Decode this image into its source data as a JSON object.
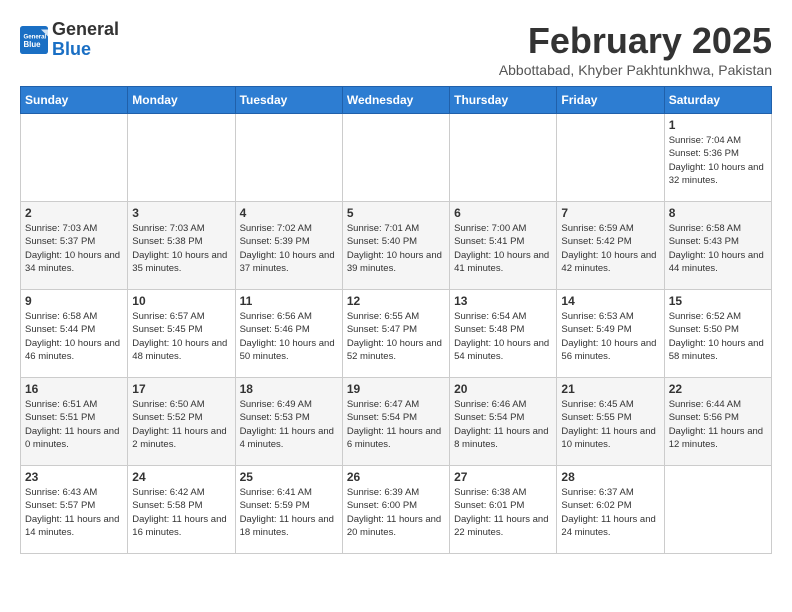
{
  "header": {
    "logo_line1": "General",
    "logo_line2": "Blue",
    "title": "February 2025",
    "subtitle": "Abbottabad, Khyber Pakhtunkhwa, Pakistan"
  },
  "days_of_week": [
    "Sunday",
    "Monday",
    "Tuesday",
    "Wednesday",
    "Thursday",
    "Friday",
    "Saturday"
  ],
  "weeks": [
    [
      {
        "day": "",
        "info": ""
      },
      {
        "day": "",
        "info": ""
      },
      {
        "day": "",
        "info": ""
      },
      {
        "day": "",
        "info": ""
      },
      {
        "day": "",
        "info": ""
      },
      {
        "day": "",
        "info": ""
      },
      {
        "day": "1",
        "info": "Sunrise: 7:04 AM\nSunset: 5:36 PM\nDaylight: 10 hours\nand 32 minutes."
      }
    ],
    [
      {
        "day": "2",
        "info": "Sunrise: 7:03 AM\nSunset: 5:37 PM\nDaylight: 10 hours\nand 34 minutes."
      },
      {
        "day": "3",
        "info": "Sunrise: 7:03 AM\nSunset: 5:38 PM\nDaylight: 10 hours\nand 35 minutes."
      },
      {
        "day": "4",
        "info": "Sunrise: 7:02 AM\nSunset: 5:39 PM\nDaylight: 10 hours\nand 37 minutes."
      },
      {
        "day": "5",
        "info": "Sunrise: 7:01 AM\nSunset: 5:40 PM\nDaylight: 10 hours\nand 39 minutes."
      },
      {
        "day": "6",
        "info": "Sunrise: 7:00 AM\nSunset: 5:41 PM\nDaylight: 10 hours\nand 41 minutes."
      },
      {
        "day": "7",
        "info": "Sunrise: 6:59 AM\nSunset: 5:42 PM\nDaylight: 10 hours\nand 42 minutes."
      },
      {
        "day": "8",
        "info": "Sunrise: 6:58 AM\nSunset: 5:43 PM\nDaylight: 10 hours\nand 44 minutes."
      }
    ],
    [
      {
        "day": "9",
        "info": "Sunrise: 6:58 AM\nSunset: 5:44 PM\nDaylight: 10 hours\nand 46 minutes."
      },
      {
        "day": "10",
        "info": "Sunrise: 6:57 AM\nSunset: 5:45 PM\nDaylight: 10 hours\nand 48 minutes."
      },
      {
        "day": "11",
        "info": "Sunrise: 6:56 AM\nSunset: 5:46 PM\nDaylight: 10 hours\nand 50 minutes."
      },
      {
        "day": "12",
        "info": "Sunrise: 6:55 AM\nSunset: 5:47 PM\nDaylight: 10 hours\nand 52 minutes."
      },
      {
        "day": "13",
        "info": "Sunrise: 6:54 AM\nSunset: 5:48 PM\nDaylight: 10 hours\nand 54 minutes."
      },
      {
        "day": "14",
        "info": "Sunrise: 6:53 AM\nSunset: 5:49 PM\nDaylight: 10 hours\nand 56 minutes."
      },
      {
        "day": "15",
        "info": "Sunrise: 6:52 AM\nSunset: 5:50 PM\nDaylight: 10 hours\nand 58 minutes."
      }
    ],
    [
      {
        "day": "16",
        "info": "Sunrise: 6:51 AM\nSunset: 5:51 PM\nDaylight: 11 hours\nand 0 minutes."
      },
      {
        "day": "17",
        "info": "Sunrise: 6:50 AM\nSunset: 5:52 PM\nDaylight: 11 hours\nand 2 minutes."
      },
      {
        "day": "18",
        "info": "Sunrise: 6:49 AM\nSunset: 5:53 PM\nDaylight: 11 hours\nand 4 minutes."
      },
      {
        "day": "19",
        "info": "Sunrise: 6:47 AM\nSunset: 5:54 PM\nDaylight: 11 hours\nand 6 minutes."
      },
      {
        "day": "20",
        "info": "Sunrise: 6:46 AM\nSunset: 5:54 PM\nDaylight: 11 hours\nand 8 minutes."
      },
      {
        "day": "21",
        "info": "Sunrise: 6:45 AM\nSunset: 5:55 PM\nDaylight: 11 hours\nand 10 minutes."
      },
      {
        "day": "22",
        "info": "Sunrise: 6:44 AM\nSunset: 5:56 PM\nDaylight: 11 hours\nand 12 minutes."
      }
    ],
    [
      {
        "day": "23",
        "info": "Sunrise: 6:43 AM\nSunset: 5:57 PM\nDaylight: 11 hours\nand 14 minutes."
      },
      {
        "day": "24",
        "info": "Sunrise: 6:42 AM\nSunset: 5:58 PM\nDaylight: 11 hours\nand 16 minutes."
      },
      {
        "day": "25",
        "info": "Sunrise: 6:41 AM\nSunset: 5:59 PM\nDaylight: 11 hours\nand 18 minutes."
      },
      {
        "day": "26",
        "info": "Sunrise: 6:39 AM\nSunset: 6:00 PM\nDaylight: 11 hours\nand 20 minutes."
      },
      {
        "day": "27",
        "info": "Sunrise: 6:38 AM\nSunset: 6:01 PM\nDaylight: 11 hours\nand 22 minutes."
      },
      {
        "day": "28",
        "info": "Sunrise: 6:37 AM\nSunset: 6:02 PM\nDaylight: 11 hours\nand 24 minutes."
      },
      {
        "day": "",
        "info": ""
      }
    ]
  ]
}
